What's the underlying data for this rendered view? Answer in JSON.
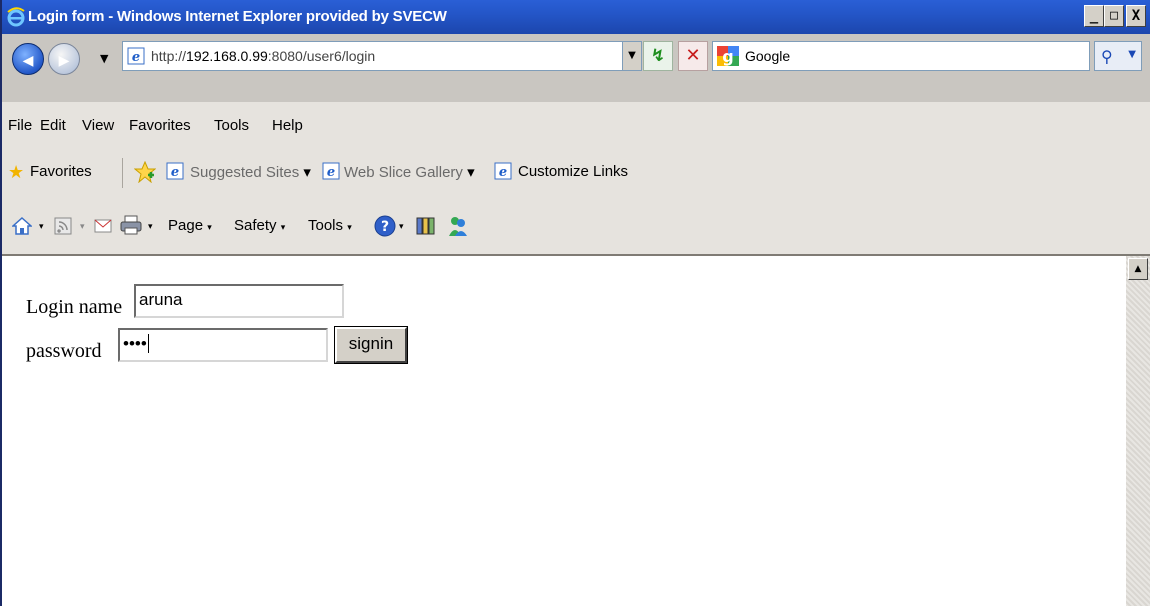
{
  "window": {
    "title": "Login form - Windows Internet Explorer provided by SVECW",
    "minimize_glyph": "_",
    "maximize_glyph": "□",
    "close_glyph": "X"
  },
  "address_bar": {
    "url_prefix": "http://",
    "url_host": "192.168.0.99",
    "url_rest": ":8080/user6/login",
    "search_engine": "Google",
    "back_glyph": "◀",
    "forward_glyph": "▶",
    "dropdown_glyph": "▼",
    "refresh_glyph": "↯",
    "stop_glyph": "✕",
    "search_glyph": "⚲"
  },
  "menu": {
    "items": [
      "File",
      "Edit",
      "View",
      "Favorites",
      "Tools",
      "Help"
    ]
  },
  "favorites_bar": {
    "favorites_label": "Favorites",
    "links": [
      "Suggested Sites",
      "Web Slice Gallery",
      "Customize Links"
    ]
  },
  "command_bar": {
    "page_label": "Page",
    "safety_label": "Safety",
    "tools_label": "Tools",
    "dropdown_glyph": "▾"
  },
  "form": {
    "login_label": "Login name",
    "login_value": "aruna",
    "password_label": "password",
    "password_mask": "••••",
    "signin_label": "signin"
  },
  "colors": {
    "title_bar": "#2456c8",
    "chrome": "#e6e3de",
    "button_face": "#d4d0c8"
  },
  "icons": [
    "ie-logo-icon",
    "back-icon",
    "forward-icon",
    "page-icon",
    "refresh-icon",
    "stop-icon",
    "google-icon",
    "search-icon",
    "star-icon",
    "add-favorite-icon",
    "home-icon",
    "feeds-icon",
    "mail-icon",
    "print-icon",
    "help-icon",
    "research-icon",
    "messenger-icon"
  ]
}
